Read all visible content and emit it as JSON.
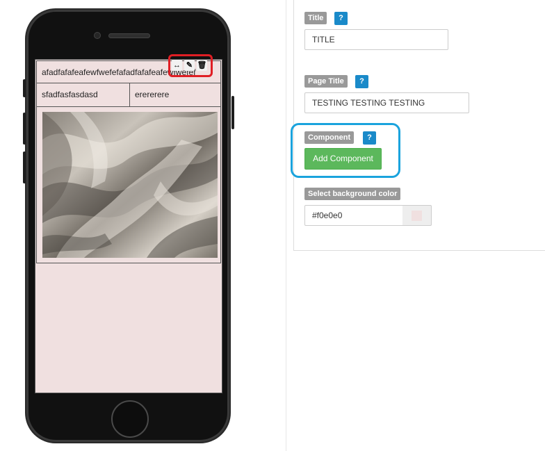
{
  "phone_screen": {
    "row1_text": "afadfafafeafewfwefefafadfafafeafewfwefef",
    "row2_col1": "sfadfasfasdasd",
    "row2_col2": "erererere",
    "background_color": "#f0e0e0"
  },
  "image_toolbar": {
    "icons": [
      "resize-icon",
      "edit-icon",
      "delete-icon"
    ],
    "highlight_color": "#e01e24"
  },
  "form": {
    "title_label": "Title",
    "title_help": "?",
    "title_value": "TITLE",
    "page_title_label": "Page Title",
    "page_title_help": "?",
    "page_title_value": "TESTING TESTING TESTING",
    "component_label": "Component",
    "component_help": "?",
    "add_component_button": "Add Component",
    "bg_color_label": "Select background color",
    "bg_color_value": "#f0e0e0"
  },
  "colors": {
    "help_badge": "#1a8ac9",
    "label_tag": "#999999",
    "add_button": "#5cb85c",
    "component_highlight": "#1aa3dd"
  }
}
